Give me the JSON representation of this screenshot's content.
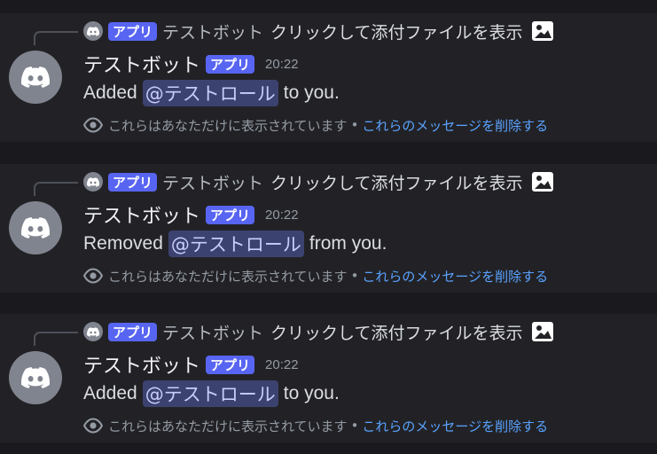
{
  "messages": [
    {
      "reply": {
        "tag": "アプリ",
        "name": "テストボット",
        "text": "クリックして添付ファイルを表示"
      },
      "author": {
        "name": "テストボット",
        "tag": "アプリ",
        "time": "20:22"
      },
      "content": {
        "before": "Added",
        "mention": "@テストロール",
        "after": "to you."
      },
      "footer": {
        "note": "これらはあなただけに表示されています",
        "separator": "•",
        "dismiss": "これらのメッセージを削除する"
      }
    },
    {
      "reply": {
        "tag": "アプリ",
        "name": "テストボット",
        "text": "クリックして添付ファイルを表示"
      },
      "author": {
        "name": "テストボット",
        "tag": "アプリ",
        "time": "20:22"
      },
      "content": {
        "before": "Removed",
        "mention": "@テストロール",
        "after": "from you."
      },
      "footer": {
        "note": "これらはあなただけに表示されています",
        "separator": "•",
        "dismiss": "これらのメッセージを削除する"
      }
    },
    {
      "reply": {
        "tag": "アプリ",
        "name": "テストボット",
        "text": "クリックして添付ファイルを表示"
      },
      "author": {
        "name": "テストボット",
        "tag": "アプリ",
        "time": "20:22"
      },
      "content": {
        "before": "Added",
        "mention": "@テストロール",
        "after": "to you."
      },
      "footer": {
        "note": "これらはあなただけに表示されています",
        "separator": "•",
        "dismiss": "これらのメッセージを削除する"
      }
    }
  ],
  "icons": {
    "avatar": "discord-logo-icon",
    "attachment": "image-icon",
    "ephemeral": "eye-icon"
  },
  "colors": {
    "background": "#1a1a1e",
    "message_background": "#222226",
    "app_tag": "#5865f2",
    "mention_background": "#3c4270",
    "mention_text": "#c9cdfb",
    "link": "#5aa2ff",
    "avatar": "#80848e"
  }
}
